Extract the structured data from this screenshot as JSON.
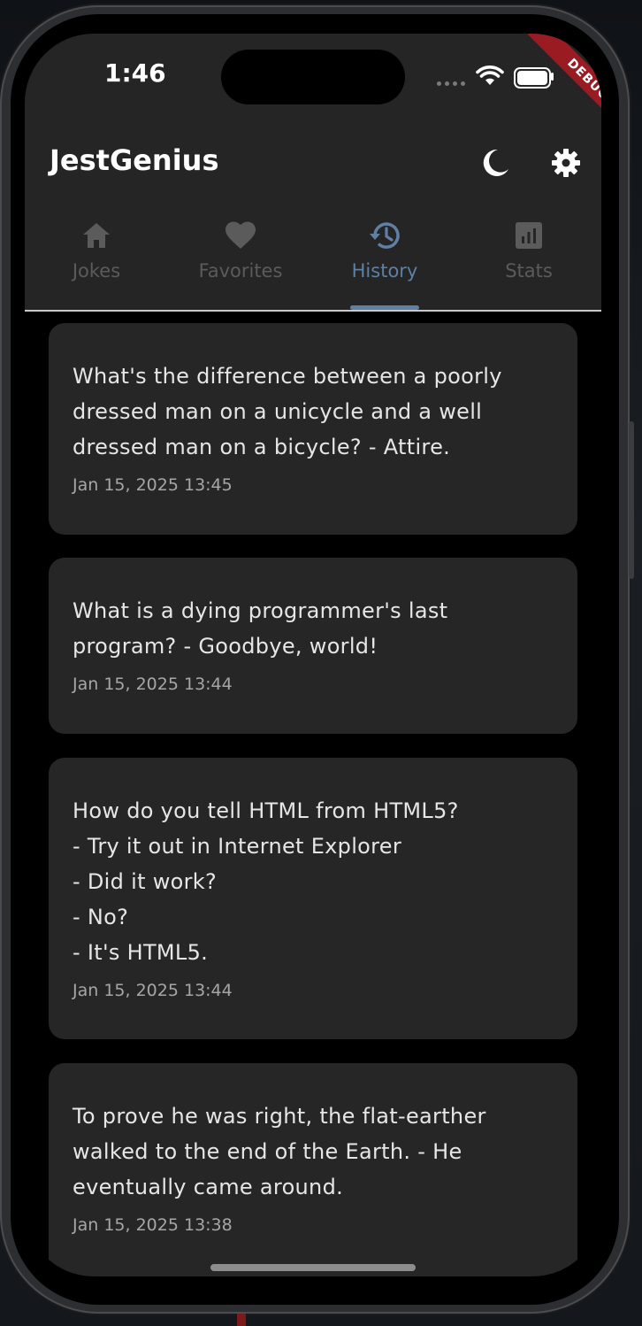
{
  "status_bar": {
    "time": "1:46"
  },
  "debug_banner": {
    "label": "DEBUG"
  },
  "app": {
    "title": "JestGenius",
    "theme_icon": "moon-icon",
    "settings_icon": "gear-icon"
  },
  "tabs": [
    {
      "label": "Jokes",
      "icon": "home-icon",
      "active": false
    },
    {
      "label": "Favorites",
      "icon": "heart-icon",
      "active": false
    },
    {
      "label": "History",
      "icon": "history-icon",
      "active": true
    },
    {
      "label": "Stats",
      "icon": "bar-chart-icon",
      "active": false
    }
  ],
  "colors": {
    "active_tab": "#5f7fa3",
    "inactive_tab": "#5b5b5b",
    "card_background": "#262626",
    "appbar_background": "#252525",
    "debug_ribbon": "#9a1b22"
  },
  "history": [
    {
      "joke": "What's the difference between a poorly\ndressed man on a unicycle and a well\ndressed man on a bicycle? - Attire.",
      "timestamp": "Jan 15, 2025 13:45"
    },
    {
      "joke": "What is a dying programmer's last\nprogram? - Goodbye, world!",
      "timestamp": "Jan 15, 2025 13:44"
    },
    {
      "joke": "How do you tell HTML from HTML5?\n- Try it out in Internet Explorer\n- Did it work?\n- No?\n- It's HTML5.",
      "timestamp": "Jan 15, 2025 13:44"
    },
    {
      "joke": "To prove he was right, the flat-earther\nwalked to the end of the Earth. - He\neventually came around.",
      "timestamp": "Jan 15, 2025 13:38"
    }
  ]
}
